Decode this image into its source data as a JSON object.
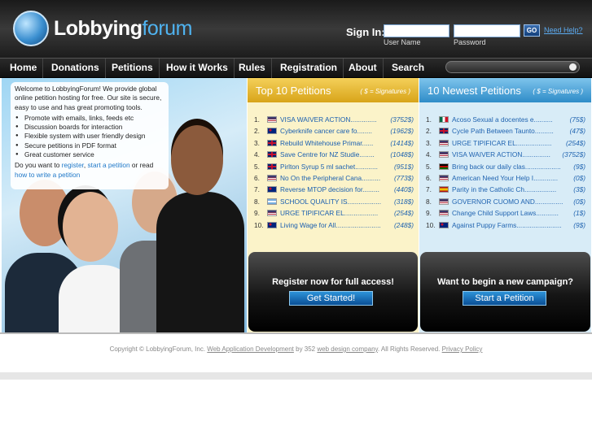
{
  "brand": {
    "name_part1": "Lobbying",
    "name_part2": "forum"
  },
  "signin": {
    "label": "Sign In:",
    "user_label": "User Name",
    "pass_label": "Password",
    "go": "GO",
    "help": "Need Help?"
  },
  "nav": [
    "Home",
    "Donations",
    "Petitions",
    "How it Works",
    "Rules",
    "Registration",
    "About",
    "Search"
  ],
  "intro": {
    "text": "Welcome to LobbyingForum! We provide global online petition hosting for free. Our site is secure, easy to use and has great promoting tools.",
    "features": [
      "Promote with emails, links, feeds etc",
      "Discussion boards for interaction",
      "Flexible system with user friendly design",
      "Secure petitions in PDF format",
      "Great customer service"
    ],
    "cta_pre": "Do you want to ",
    "register": "register",
    ", ": ", ",
    "start": "start a petition",
    " or read ": " or read ",
    "how": "how to write a petition"
  },
  "top10": {
    "title": "Top 10 Petitions",
    "sub": "( $ = Signatures )",
    "items": [
      {
        "num": "1.",
        "title": "VISA WAIVER ACTION..............",
        "count": "(3752$)",
        "flag": "us"
      },
      {
        "num": "2.",
        "title": "Cyberknife cancer care fo........",
        "count": "(1962$)",
        "flag": "au"
      },
      {
        "num": "3.",
        "title": "Rebuild Whitehouse Primar......",
        "count": "(1414$)",
        "flag": "uk"
      },
      {
        "num": "4.",
        "title": "Save Centre for NZ Studie........",
        "count": "(1048$)",
        "flag": "uk"
      },
      {
        "num": "5.",
        "title": "Pirlton Syrup 5 ml sachet............",
        "count": "(951$)",
        "flag": "uk"
      },
      {
        "num": "6.",
        "title": "No On the Peripheral Cana..........",
        "count": "(773$)",
        "flag": "us"
      },
      {
        "num": "7.",
        "title": "Reverse MTOP decision for.........",
        "count": "(440$)",
        "flag": "au"
      },
      {
        "num": "8.",
        "title": "SCHOOL QUALITY IS..................",
        "count": "(318$)",
        "flag": "ar"
      },
      {
        "num": "9.",
        "title": "URGE TIPIFICAR EL..................",
        "count": "(254$)",
        "flag": "us"
      },
      {
        "num": "10.",
        "title": "Living Wage for All........................",
        "count": "(248$)",
        "flag": "au"
      }
    ]
  },
  "newest": {
    "title": "10 Newest Petitions",
    "sub": "( $ = Signatures )",
    "items": [
      {
        "num": "1.",
        "title": "Acoso Sexual a docentes e..........",
        "count": "(75$)",
        "flag": "mx"
      },
      {
        "num": "2.",
        "title": "Cycle Path Between Taunto..........",
        "count": "(47$)",
        "flag": "uk"
      },
      {
        "num": "3.",
        "title": "URGE TIPIFICAR EL...................",
        "count": "(254$)",
        "flag": "us"
      },
      {
        "num": "4.",
        "title": "VISA WAIVER ACTION...............",
        "count": "(3752$)",
        "flag": "us"
      },
      {
        "num": "5.",
        "title": "Bring back our daily clas...................",
        "count": "(9$)",
        "flag": "ke"
      },
      {
        "num": "6.",
        "title": "American Need Your Help I.............",
        "count": "(0$)",
        "flag": "us"
      },
      {
        "num": "7.",
        "title": "Parity in the Catholic Ch.................",
        "count": "(3$)",
        "flag": "es"
      },
      {
        "num": "8.",
        "title": "GOVERNOR CUOMO AND...............",
        "count": "(0$)",
        "flag": "us"
      },
      {
        "num": "9.",
        "title": "Change Child Support Laws............",
        "count": "(1$)",
        "flag": "us"
      },
      {
        "num": "10.",
        "title": "Against Puppy Farms........................",
        "count": "(9$)",
        "flag": "au"
      }
    ]
  },
  "cta": {
    "register_text": "Register now for full access!",
    "register_btn": "Get Started!",
    "campaign_text": "Want to begin a new campaign?",
    "campaign_btn": "Start a Petition"
  },
  "footer": {
    "pre": "Copyright © LobbyingForum, Inc. ",
    "link1": "Web Application Development",
    "mid": " by 352 ",
    "link2": "web design company",
    ". All Rights Reserved. ": ". All Rights Reserved. ",
    "link3": "Privacy Policy"
  },
  "colors": {
    "accent": "#4fb3f0",
    "top10_header": "#e0b22a",
    "newest_header": "#3d9bd6",
    "link": "#1f63b0"
  }
}
